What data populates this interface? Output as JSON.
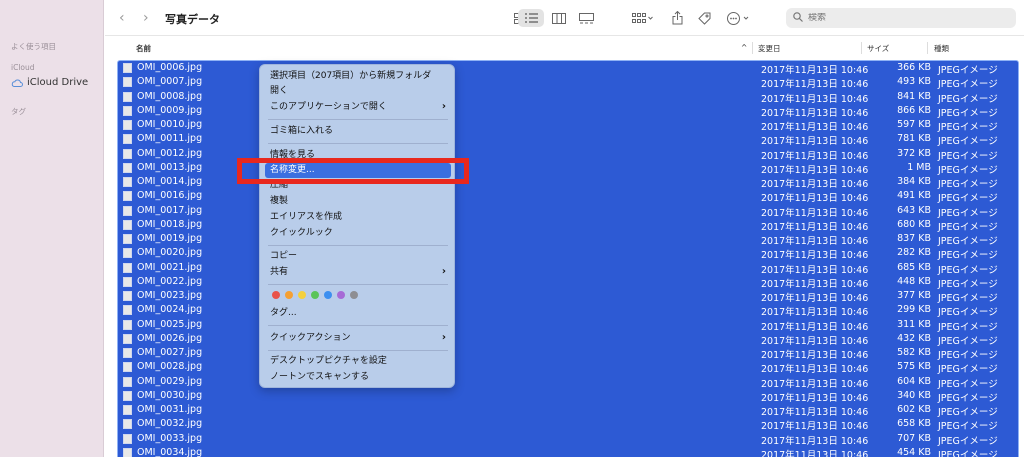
{
  "window": {
    "title": "写真データ"
  },
  "sidebar": {
    "favorites_heading": "よく使う項目",
    "icloud_heading": "iCloud",
    "icloud_drive": "iCloud Drive",
    "tags_heading": "タグ"
  },
  "toolbar": {
    "back": "‹",
    "forward": "›",
    "search_placeholder": "検索"
  },
  "columns": {
    "name": "名前",
    "modified": "変更日",
    "size": "サイズ",
    "kind": "種類",
    "sort_indicator": "^"
  },
  "files": [
    {
      "name": "OMI_0006.jpg",
      "date": "2017年11月13日 10:46",
      "size": "366 KB",
      "kind": "JPEGイメージ"
    },
    {
      "name": "OMI_0007.jpg",
      "date": "2017年11月13日 10:46",
      "size": "493 KB",
      "kind": "JPEGイメージ"
    },
    {
      "name": "OMI_0008.jpg",
      "date": "2017年11月13日 10:46",
      "size": "841 KB",
      "kind": "JPEGイメージ"
    },
    {
      "name": "OMI_0009.jpg",
      "date": "2017年11月13日 10:46",
      "size": "866 KB",
      "kind": "JPEGイメージ"
    },
    {
      "name": "OMI_0010.jpg",
      "date": "2017年11月13日 10:46",
      "size": "597 KB",
      "kind": "JPEGイメージ"
    },
    {
      "name": "OMI_0011.jpg",
      "date": "2017年11月13日 10:46",
      "size": "781 KB",
      "kind": "JPEGイメージ"
    },
    {
      "name": "OMI_0012.jpg",
      "date": "2017年11月13日 10:46",
      "size": "372 KB",
      "kind": "JPEGイメージ"
    },
    {
      "name": "OMI_0013.jpg",
      "date": "2017年11月13日 10:46",
      "size": "1 MB",
      "kind": "JPEGイメージ"
    },
    {
      "name": "OMI_0014.jpg",
      "date": "2017年11月13日 10:46",
      "size": "384 KB",
      "kind": "JPEGイメージ"
    },
    {
      "name": "OMI_0016.jpg",
      "date": "2017年11月13日 10:46",
      "size": "491 KB",
      "kind": "JPEGイメージ"
    },
    {
      "name": "OMI_0017.jpg",
      "date": "2017年11月13日 10:46",
      "size": "643 KB",
      "kind": "JPEGイメージ"
    },
    {
      "name": "OMI_0018.jpg",
      "date": "2017年11月13日 10:46",
      "size": "680 KB",
      "kind": "JPEGイメージ"
    },
    {
      "name": "OMI_0019.jpg",
      "date": "2017年11月13日 10:46",
      "size": "837 KB",
      "kind": "JPEGイメージ"
    },
    {
      "name": "OMI_0020.jpg",
      "date": "2017年11月13日 10:46",
      "size": "282 KB",
      "kind": "JPEGイメージ"
    },
    {
      "name": "OMI_0021.jpg",
      "date": "2017年11月13日 10:46",
      "size": "685 KB",
      "kind": "JPEGイメージ"
    },
    {
      "name": "OMI_0022.jpg",
      "date": "2017年11月13日 10:46",
      "size": "448 KB",
      "kind": "JPEGイメージ"
    },
    {
      "name": "OMI_0023.jpg",
      "date": "2017年11月13日 10:46",
      "size": "377 KB",
      "kind": "JPEGイメージ"
    },
    {
      "name": "OMI_0024.jpg",
      "date": "2017年11月13日 10:46",
      "size": "299 KB",
      "kind": "JPEGイメージ"
    },
    {
      "name": "OMI_0025.jpg",
      "date": "2017年11月13日 10:46",
      "size": "311 KB",
      "kind": "JPEGイメージ"
    },
    {
      "name": "OMI_0026.jpg",
      "date": "2017年11月13日 10:46",
      "size": "432 KB",
      "kind": "JPEGイメージ"
    },
    {
      "name": "OMI_0027.jpg",
      "date": "2017年11月13日 10:46",
      "size": "582 KB",
      "kind": "JPEGイメージ"
    },
    {
      "name": "OMI_0028.jpg",
      "date": "2017年11月13日 10:46",
      "size": "575 KB",
      "kind": "JPEGイメージ"
    },
    {
      "name": "OMI_0029.jpg",
      "date": "2017年11月13日 10:46",
      "size": "604 KB",
      "kind": "JPEGイメージ"
    },
    {
      "name": "OMI_0030.jpg",
      "date": "2017年11月13日 10:46",
      "size": "340 KB",
      "kind": "JPEGイメージ"
    },
    {
      "name": "OMI_0031.jpg",
      "date": "2017年11月13日 10:46",
      "size": "602 KB",
      "kind": "JPEGイメージ"
    },
    {
      "name": "OMI_0032.jpg",
      "date": "2017年11月13日 10:46",
      "size": "658 KB",
      "kind": "JPEGイメージ"
    },
    {
      "name": "OMI_0033.jpg",
      "date": "2017年11月13日 10:46",
      "size": "707 KB",
      "kind": "JPEGイメージ"
    },
    {
      "name": "OMI_0034.jpg",
      "date": "2017年11月13日 10:46",
      "size": "454 KB",
      "kind": "JPEGイメージ"
    }
  ],
  "context_menu": {
    "new_folder_with_selection": "選択項目（207項目）から新規フォルダ",
    "open": "開く",
    "open_with": "このアプリケーションで開く",
    "move_to_trash": "ゴミ箱に入れる",
    "get_info": "情報を見る",
    "rename": "名称変更...",
    "compress": "圧縮",
    "duplicate": "複製",
    "make_alias": "エイリアスを作成",
    "quick_look": "クイックルック",
    "copy": "コピー",
    "share": "共有",
    "tags": "タグ...",
    "quick_actions": "クイックアクション",
    "set_desktop_picture": "デスクトップピクチャを設定",
    "scan_with_norton": "ノートンでスキャンする",
    "submenu_chevron": "›",
    "tag_colors": [
      "#e8524a",
      "#f5a033",
      "#f4d03f",
      "#5bc45a",
      "#3d8ff0",
      "#a66bd6",
      "#8e8e93"
    ]
  },
  "colors": {
    "selection": "#2d5ad4",
    "menu_bg": "#b9cdea",
    "menu_highlight": "#3b6fe0",
    "annotation": "#e8281e"
  }
}
